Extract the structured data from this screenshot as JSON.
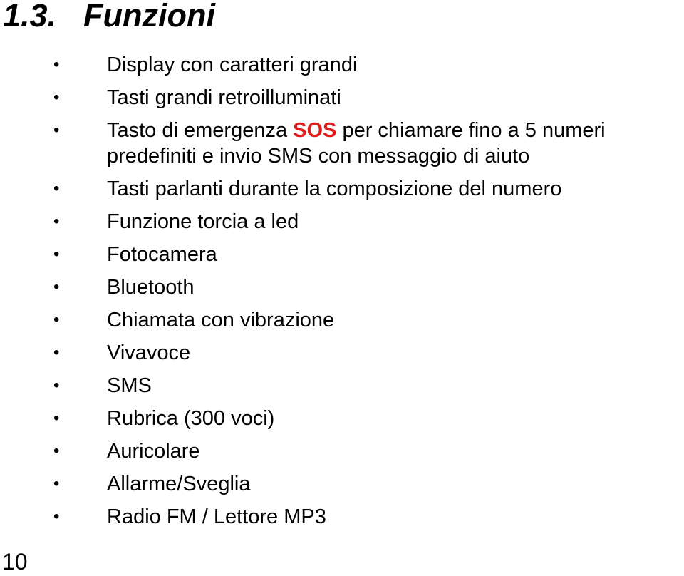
{
  "section": {
    "number": "1.3.",
    "title": "Funzioni"
  },
  "bullet": "•",
  "items": [
    {
      "text": "Display con caratteri grandi"
    },
    {
      "text": "Tasti grandi retroilluminati"
    },
    {
      "pre": "Tasto di emergenza ",
      "highlight": "SOS",
      "post": " per chiamare fino a 5 numeri predefiniti e invio SMS con messaggio di aiuto"
    },
    {
      "text": "Tasti parlanti durante la composizione del numero"
    },
    {
      "text": "Funzione torcia a led"
    },
    {
      "text": "Fotocamera"
    },
    {
      "text": "Bluetooth"
    },
    {
      "text": "Chiamata con vibrazione"
    },
    {
      "text": "Vivavoce"
    },
    {
      "text": "SMS"
    },
    {
      "text": "Rubrica (300 voci)"
    },
    {
      "text": "Auricolare"
    },
    {
      "text": "Allarme/Sveglia"
    },
    {
      "text": "Radio FM / Lettore MP3"
    }
  ],
  "highlight_color": "#e01b1b",
  "page_number": "10"
}
